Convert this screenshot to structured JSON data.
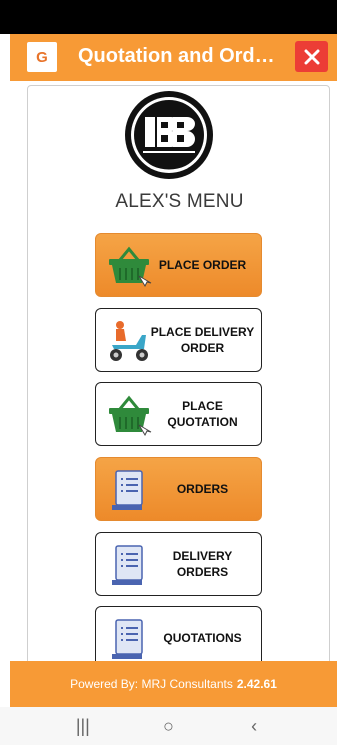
{
  "header": {
    "title": "Quotation and Orde...",
    "logo_letter": "G",
    "close_icon": "close-icon"
  },
  "menu": {
    "title": "ALEX'S MENU",
    "items": [
      {
        "label": "PLACE ORDER",
        "icon": "basket-icon",
        "active": true
      },
      {
        "label": "PLACE DELIVERY ORDER",
        "icon": "delivery-scooter-icon",
        "active": false
      },
      {
        "label": "PLACE QUOTATION",
        "icon": "basket-icon",
        "active": false
      },
      {
        "label": "ORDERS",
        "icon": "document-icon",
        "active": true
      },
      {
        "label": "DELIVERY ORDERS",
        "icon": "document-icon",
        "active": false
      },
      {
        "label": "QUOTATIONS",
        "icon": "document-icon",
        "active": false
      }
    ]
  },
  "footer": {
    "text": "Powered By: MRJ Consultants",
    "version": "2.42.61"
  },
  "nav": {
    "recents": "|||",
    "home": "○",
    "back": "‹"
  },
  "colors": {
    "accent": "#f79a36",
    "close": "#ec3d36",
    "basket": "#2f8a3b",
    "document": "#4a64b0"
  }
}
